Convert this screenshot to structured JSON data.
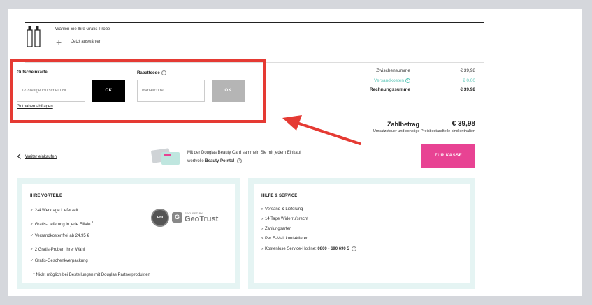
{
  "sample": {
    "title": "Wählen Sie Ihre Gratis-Probe",
    "link": "Jetzt auswählen"
  },
  "voucher": {
    "giftcard_label": "Gutscheinkarte",
    "giftcard_placeholder": "17-stellige Gutschein Nr.",
    "giftcard_ok": "OK",
    "discount_label": "Rabattcode",
    "discount_placeholder": "Rabattcode",
    "discount_ok": "OK",
    "balance_link": "Guthaben abfragen"
  },
  "summary": {
    "subtotal_label": "Zwischensumme",
    "subtotal_value": "€ 39,98",
    "shipping_label": "Versandkosten",
    "shipping_value": "€ 0,00",
    "invoice_label": "Rechnungssumme",
    "invoice_value": "€ 39,98",
    "total_label": "Zahlbetrag",
    "total_value": "€ 39,98",
    "total_note": "Umsatzsteuer und sonstige Preisbestandteile sind enthalten"
  },
  "actions": {
    "continue_shopping": "Weiter einkaufen",
    "checkout": "ZUR KASSE"
  },
  "beauty": {
    "line1": "Mit der Douglas Beauty Card sammeln Sie mit jedem Einkauf",
    "line2_prefix": "wertvolle",
    "line2_bold": "Beauty Points!"
  },
  "benefits": {
    "title": "IHRE VORTEILE",
    "items": [
      "2-4 Werktage Lieferzeit",
      "Gratis-Lieferung in jede Filiale",
      "Versandkostenfrei ab 24,95 €",
      "2 Gratis-Proben Ihrer Wahl",
      "Gratis-Geschenkverpackung"
    ],
    "footnote": "Nicht möglich bei Bestellungen mit Douglas Partnerprodukten",
    "footnote_mark": "1",
    "seal_text": "EHI",
    "geotrust_small": "SECURED BY",
    "geotrust_big": "GeoTrust"
  },
  "help": {
    "title": "HILFE & SERVICE",
    "items": [
      "Versand & Lieferung",
      "14 Tage Widerrufsrecht",
      "Zahlungsarten",
      "Per E-Mail kontaktieren"
    ],
    "hotline_prefix": "Kostenlose Service-Hotline:",
    "hotline_number": "0800 - 690 690 5"
  },
  "colors": {
    "accent_pink": "#e84393",
    "highlight_red": "#e53a33",
    "teal": "#5cc6b8",
    "box_bg": "#e5f4f3"
  }
}
